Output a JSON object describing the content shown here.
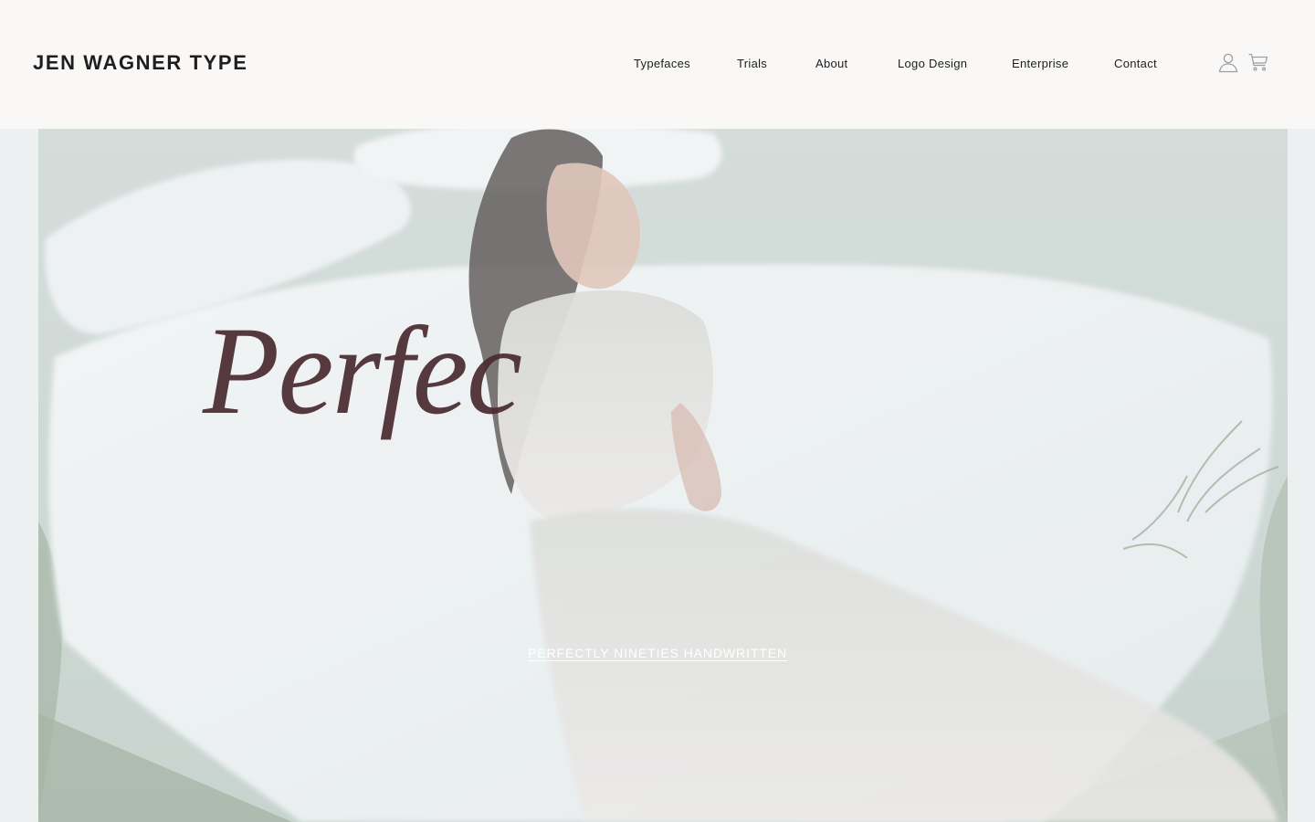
{
  "site": {
    "logo": "JEN WAGNER TYPE"
  },
  "nav": {
    "items": [
      {
        "label": "Typefaces"
      },
      {
        "label": "Trials"
      },
      {
        "label": "About"
      },
      {
        "label": "Logo Design"
      },
      {
        "label": "Enterprise"
      },
      {
        "label": "Contact"
      }
    ],
    "account_icon": "user-icon",
    "cart_icon": "cart-icon"
  },
  "hero": {
    "specimen_text": "Perfec",
    "cta_label": "PERFECTLY NINETIES HANDWRITTEN",
    "colors": {
      "specimen": "#4a2a2f",
      "cta": "#ffffff",
      "header_bg": "#f9f8f7"
    }
  }
}
